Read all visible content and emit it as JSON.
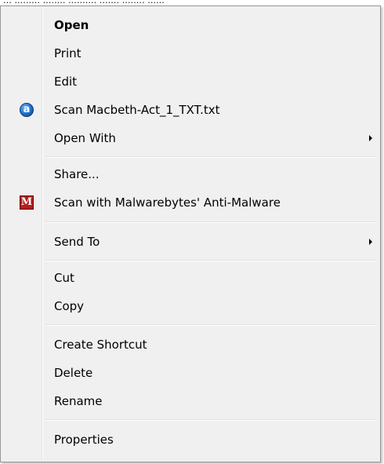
{
  "background_window": {
    "clipped_text": "... ......... ........ .......... ....... ........ ......"
  },
  "menu": {
    "items": [
      {
        "label": "Open"
      },
      {
        "label": "Print"
      },
      {
        "label": "Edit"
      },
      {
        "label": "Scan Macbeth-Act_1_TXT.txt",
        "icon": "avast-icon",
        "icon_glyph": "a"
      },
      {
        "label": "Open With",
        "submenu": true
      },
      {
        "label": "Share..."
      },
      {
        "label": "Scan with Malwarebytes' Anti-Malware",
        "icon": "malwarebytes-icon",
        "icon_glyph": "M"
      },
      {
        "label": "Send To",
        "submenu": true
      },
      {
        "label": "Cut"
      },
      {
        "label": "Copy"
      },
      {
        "label": "Create Shortcut"
      },
      {
        "label": "Delete"
      },
      {
        "label": "Rename"
      },
      {
        "label": "Properties"
      }
    ]
  },
  "colors": {
    "menu_background": "#f0f0f0",
    "menu_border": "#979797",
    "text": "#000000",
    "avast_blue": "#1b6fc8",
    "malwarebytes_red": "#b51d1d"
  }
}
